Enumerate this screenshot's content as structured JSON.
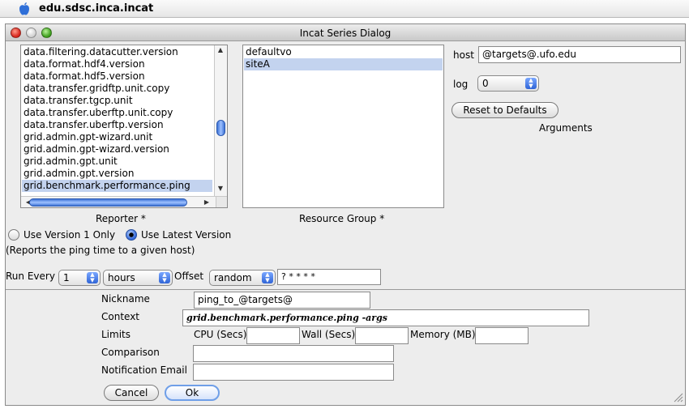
{
  "menubar": {
    "app_name": "edu.sdsc.inca.incat"
  },
  "window": {
    "title": "Incat Series Dialog"
  },
  "reporter_list": {
    "items": [
      "data.filtering.datacutter.version",
      "data.format.hdf4.version",
      "data.format.hdf5.version",
      "data.transfer.gridftp.unit.copy",
      "data.transfer.tgcp.unit",
      "data.transfer.uberftp.unit.copy",
      "data.transfer.uberftp.version",
      "grid.admin.gpt-wizard.unit",
      "grid.admin.gpt-wizard.version",
      "grid.admin.gpt.unit",
      "grid.admin.gpt.version",
      "grid.benchmark.performance.ping"
    ],
    "selected": "grid.benchmark.performance.ping",
    "caption": "Reporter *"
  },
  "resource_list": {
    "items": [
      "defaultvo",
      "siteA"
    ],
    "selected": "siteA",
    "caption": "Resource Group *"
  },
  "args": {
    "host_label": "host",
    "host_value": "@targets@.ufo.edu",
    "log_label": "log",
    "log_value": "0",
    "reset_label": "Reset to Defaults",
    "arguments_label": "Arguments"
  },
  "version": {
    "v1_label": "Use Version 1 Only",
    "latest_label": "Use Latest Version",
    "selected": "latest",
    "description": "(Reports the ping time to a given host)"
  },
  "schedule": {
    "run_every_label": "Run Every",
    "run_count": "1",
    "unit": "hours",
    "offset_label": "Offset",
    "offset_mode": "random",
    "offset_value": "? * * * *"
  },
  "form": {
    "nickname_label": "Nickname",
    "nickname_value": "ping_to_@targets@",
    "context_label": "Context",
    "context_value": "grid.benchmark.performance.ping -args",
    "limits_label": "Limits",
    "cpu_label": "CPU (Secs)",
    "wall_label": "Wall (Secs)",
    "memory_label": "Memory (MB)",
    "comparison_label": "Comparison",
    "email_label": "Notification Email"
  },
  "buttons": {
    "cancel_label": "Cancel",
    "ok_label": "Ok"
  },
  "colors": {
    "selection": "#c3d3ef",
    "accent": "#2f64d6"
  }
}
